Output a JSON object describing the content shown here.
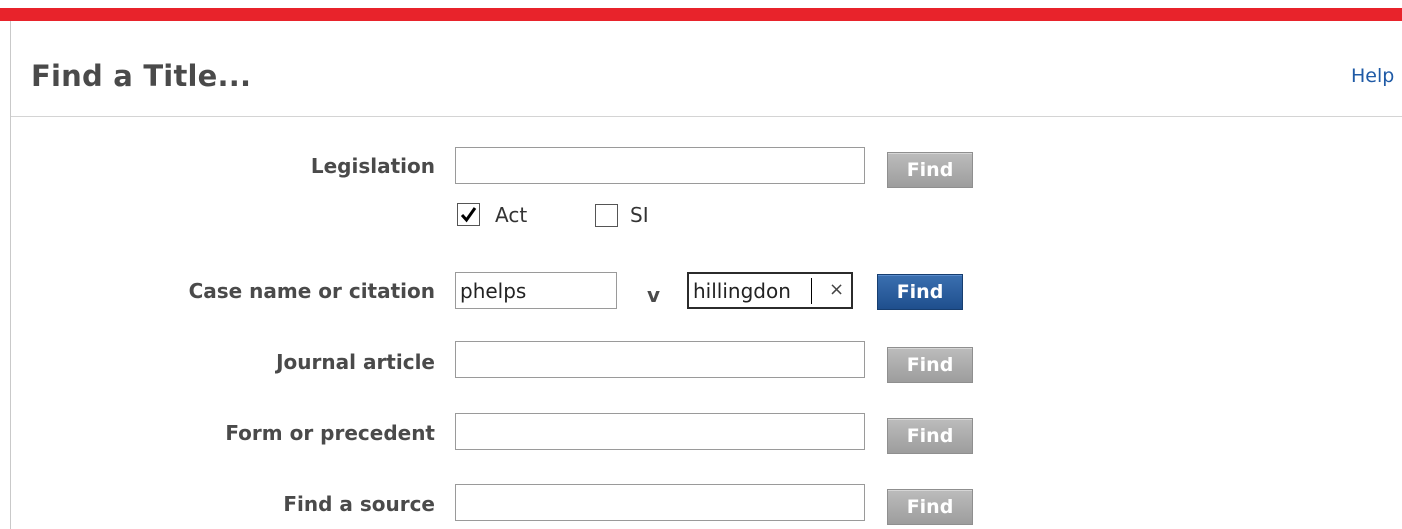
{
  "header": {
    "title": "Find a Title...",
    "help_label": "Help"
  },
  "legislation": {
    "label": "Legislation",
    "value": "",
    "find_label": "Find",
    "act": {
      "label": "Act",
      "checked": true
    },
    "si": {
      "label": "SI",
      "checked": false
    }
  },
  "case": {
    "label": "Case name or citation",
    "party1_value": "phelps",
    "versus": "v",
    "party2_value": "hillingdon",
    "clear_glyph": "×",
    "find_label": "Find"
  },
  "journal": {
    "label": "Journal article",
    "value": "",
    "find_label": "Find"
  },
  "form": {
    "label": "Form or precedent",
    "value": "",
    "find_label": "Find"
  },
  "source": {
    "label": "Find a source",
    "value": "",
    "find_label": "Find"
  },
  "colors": {
    "accent_red": "#e8232b",
    "link_blue": "#1f5aa6",
    "active_button": "#2a5e9e",
    "inactive_button": "#a6a6a6"
  }
}
